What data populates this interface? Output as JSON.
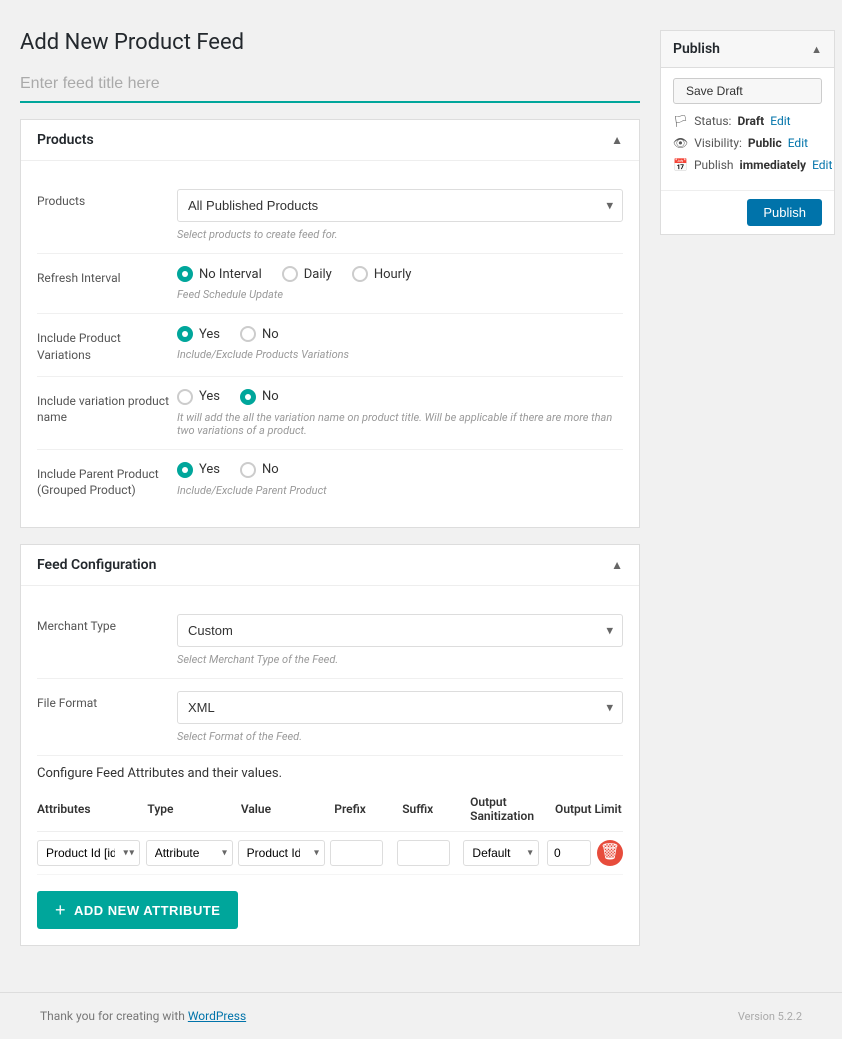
{
  "page": {
    "title": "Add New Product Feed",
    "feed_title_placeholder": "Enter feed title here"
  },
  "products_section": {
    "title": "Products",
    "products_label": "Products",
    "products_dropdown_value": "All Published Products",
    "products_hint": "Select products to create feed for.",
    "refresh_label": "Refresh Interval",
    "refresh_options": [
      {
        "label": "No Interval",
        "checked": true
      },
      {
        "label": "Daily",
        "checked": false
      },
      {
        "label": "Hourly",
        "checked": false
      }
    ],
    "refresh_hint": "Feed Schedule Update",
    "include_variations_label": "Include Product Variations",
    "include_variations_yes": "Yes",
    "include_variations_no": "No",
    "include_variations_yes_checked": true,
    "include_variations_hint": "Include/Exclude Products Variations",
    "variation_name_label": "Include variation product name",
    "variation_name_yes": "Yes",
    "variation_name_no": "No",
    "variation_name_yes_checked": false,
    "variation_name_hint": "It will add the all the variation name on product title. Will be applicable if there are more than two variations of a product.",
    "parent_product_label": "Include Parent Product (Grouped Product)",
    "parent_product_yes": "Yes",
    "parent_product_no": "No",
    "parent_product_yes_checked": true,
    "parent_product_hint": "Include/Exclude Parent Product"
  },
  "feed_config_section": {
    "title": "Feed Configuration",
    "merchant_type_label": "Merchant Type",
    "merchant_type_value": "Custom",
    "merchant_type_hint": "Select Merchant Type of the Feed.",
    "file_format_label": "File Format",
    "file_format_value": "XML",
    "file_format_hint": "Select Format of the Feed.",
    "configure_text": "Configure Feed Attributes and their values."
  },
  "attributes_table": {
    "headers": [
      "Attributes",
      "Type",
      "Value",
      "Prefix",
      "Suffix",
      "Output Sanitization",
      "Output Limit"
    ],
    "rows": [
      {
        "attribute": "Product Id [id]",
        "type": "Attribute",
        "value": "Product Id",
        "prefix": "",
        "suffix": "",
        "output_sanitization": "Default",
        "output_limit": "0"
      }
    ]
  },
  "add_attribute_btn": "ADD NEW ATTRIBUTE",
  "publish_box": {
    "title": "Publish",
    "save_draft_label": "Save Draft",
    "status_label": "Status:",
    "status_value": "Draft",
    "status_edit": "Edit",
    "visibility_label": "Visibility:",
    "visibility_value": "Public",
    "visibility_edit": "Edit",
    "publish_label": "Publish",
    "publish_value": "immediately",
    "publish_edit": "Edit",
    "publish_btn": "Publish"
  },
  "footer": {
    "version": "Version 5.2.2",
    "thank_you": "Thank you for creating with "
  }
}
